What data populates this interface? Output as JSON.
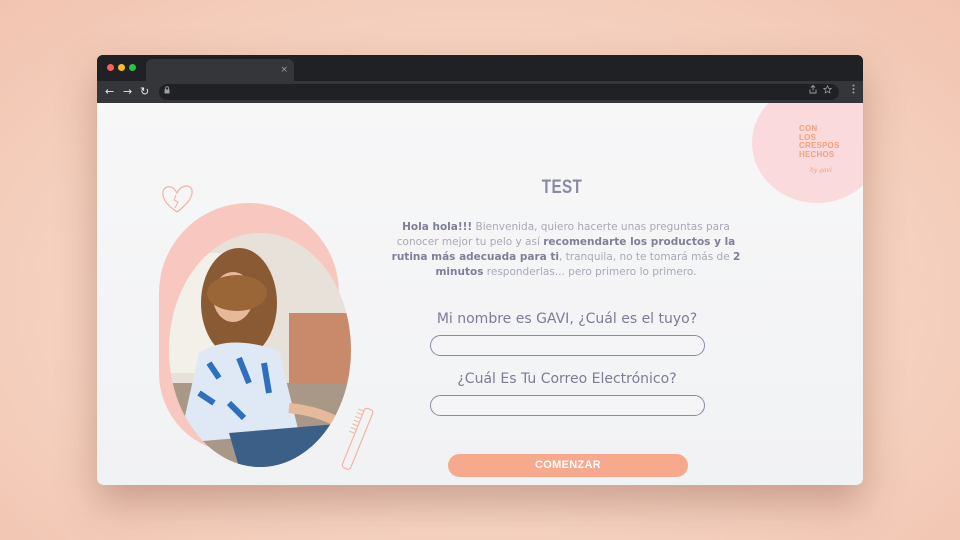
{
  "browser": {
    "tab_close": "×",
    "nav": {
      "back": "←",
      "forward": "→",
      "reload": "↻"
    }
  },
  "brand": {
    "logo_lines": [
      "CON",
      "LOS",
      "CRESPOS",
      "HECHOS"
    ],
    "signature": "by gavi"
  },
  "content": {
    "title": "TEST",
    "intro": [
      {
        "text": "Hola hola!!!",
        "bold": true
      },
      {
        "text": " Bienvenida, quiero hacerte unas preguntas para conocer mejor tu pelo y así ",
        "bold": false
      },
      {
        "text": "recomendarte los productos y la rutina más adecuada para ti",
        "bold": true
      },
      {
        "text": ", tranquila, no te tomará más de ",
        "bold": false
      },
      {
        "text": "2 minutos",
        "bold": true
      },
      {
        "text": " responderlas... pero primero lo primero.",
        "bold": false
      }
    ],
    "name_question": "Mi nombre es GAVI, ¿Cuál es el tuyo?",
    "name_value": "",
    "email_question": "¿Cuál Es Tu Correo Electrónico?",
    "email_value": "",
    "submit_label": "COMENZAR"
  },
  "colors": {
    "accent": "#f7a98e",
    "title": "#8a8aa3",
    "blob": "#f8c7bf",
    "logo": "#f1a17c"
  },
  "icons": [
    "heart-icon",
    "comb-icon",
    "lock-icon",
    "share-icon",
    "star-icon",
    "menu-icon"
  ]
}
